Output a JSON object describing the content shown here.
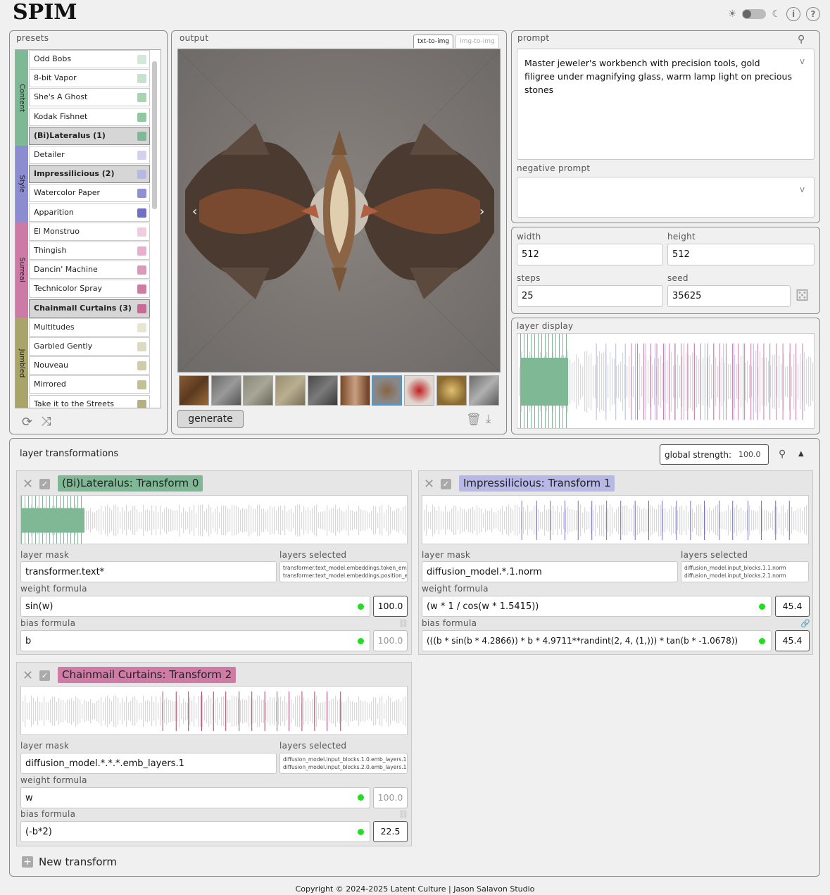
{
  "app": {
    "title": "SPIM"
  },
  "presets": {
    "label": "presets",
    "groups": [
      {
        "name": "Content",
        "color": "#7fb894"
      },
      {
        "name": "Style",
        "color": "#8c8cd0"
      },
      {
        "name": "Surreal",
        "color": "#cc7aa6"
      },
      {
        "name": "Jumbled",
        "color": "#a8a46a"
      }
    ],
    "items": [
      {
        "label": "Odd Bobs",
        "swatch": "#d4e8da",
        "selected": false
      },
      {
        "label": "8-bit Vapor",
        "swatch": "#c4e2cc",
        "selected": false
      },
      {
        "label": "She's A Ghost",
        "swatch": "#a8d4b4",
        "selected": false
      },
      {
        "label": "Kodak Fishnet",
        "swatch": "#90c8a0",
        "selected": false
      },
      {
        "label": "(Bi)Lateralus (1)",
        "swatch": "#7fb894",
        "selected": true
      },
      {
        "label": "Detailer",
        "swatch": "#d2d2ee",
        "selected": false
      },
      {
        "label": "Impressilicious (2)",
        "swatch": "#b8b8e6",
        "selected": true
      },
      {
        "label": "Watercolor Paper",
        "swatch": "#9090d4",
        "selected": false
      },
      {
        "label": "Apparition",
        "swatch": "#7070c4",
        "selected": false
      },
      {
        "label": "El Monstruo",
        "swatch": "#f0ccde",
        "selected": false
      },
      {
        "label": "Thingish",
        "swatch": "#e8b0cc",
        "selected": false
      },
      {
        "label": "Dancin' Machine",
        "swatch": "#de98ba",
        "selected": false
      },
      {
        "label": "Technicolor Spray",
        "swatch": "#d07aa6",
        "selected": false
      },
      {
        "label": "Chainmail Curtains (3)",
        "swatch": "#c86a98",
        "selected": true
      },
      {
        "label": "Multitudes",
        "swatch": "#e6e6d2",
        "selected": false
      },
      {
        "label": "Garbled Gently",
        "swatch": "#dcdac0",
        "selected": false
      },
      {
        "label": "Nouveau",
        "swatch": "#d0cca8",
        "selected": false
      },
      {
        "label": "Mirrored",
        "swatch": "#c4c096",
        "selected": false
      },
      {
        "label": "Take it to the Streets",
        "swatch": "#b4b080",
        "selected": false
      }
    ]
  },
  "output": {
    "label": "output",
    "tabs": [
      "txt-to-img",
      "img-to-img"
    ],
    "generate_label": "generate"
  },
  "prompt": {
    "label": "prompt",
    "value": "Master jeweler's workbench with precision tools, gold filigree under magnifying glass, warm lamp light on precious stones",
    "negative_label": "negative prompt",
    "negative_value": ""
  },
  "params": {
    "width_label": "width",
    "width": "512",
    "height_label": "height",
    "height": "512",
    "steps_label": "steps",
    "steps": "25",
    "seed_label": "seed",
    "seed": "35625"
  },
  "layer_display": {
    "label": "layer display"
  },
  "layer_transformations": {
    "label": "layer transformations",
    "global_strength_label": "global strength:",
    "global_strength": "100.0",
    "new_transform_label": "New transform",
    "transforms": [
      {
        "title": "(Bi)Lateralus: Transform 0",
        "color": "#7fb894",
        "layer_mask_label": "layer mask",
        "layer_mask": "transformer.text*",
        "layers_selected_label": "layers selected",
        "layers_selected": [
          "transformer.text_model.embeddings.token_embed",
          "transformer.text_model.embeddings.position_emb"
        ],
        "weight_label": "weight formula",
        "weight": "sin(w)",
        "weight_value": "100.0",
        "bias_label": "bias formula",
        "bias": "b",
        "bias_value": "100.0"
      },
      {
        "title": "Impressilicious: Transform 1",
        "color": "#b8b8e6",
        "layer_mask_label": "layer mask",
        "layer_mask": "diffusion_model.*.1.norm",
        "layers_selected_label": "layers selected",
        "layers_selected": [
          "diffusion_model.input_blocks.1.1.norm",
          "diffusion_model.input_blocks.2.1.norm"
        ],
        "weight_label": "weight formula",
        "weight": "(w * 1 / cos(w * 1.5415))",
        "weight_value": "45.4",
        "bias_label": "bias formula",
        "bias": "(((b * sin(b * 4.2866)) * b * 4.9711**randint(2, 4, (1,))) * tan(b * -1.0678))",
        "bias_value": "45.4"
      },
      {
        "title": "Chainmail Curtains: Transform 2",
        "color": "#d07aa6",
        "layer_mask_label": "layer mask",
        "layer_mask": "diffusion_model.*.*.*.emb_layers.1",
        "layers_selected_label": "layers selected",
        "layers_selected": [
          "diffusion_model.input_blocks.1.0.emb_layers.1",
          "diffusion_model.input_blocks.2.0.emb_layers.1"
        ],
        "weight_label": "weight formula",
        "weight": "w",
        "weight_value": "100.0",
        "bias_label": "bias formula",
        "bias": "(-b*2)",
        "bias_value": "22.5"
      }
    ]
  },
  "footer": {
    "text": "Copyright © 2024-2025  Latent Culture | Jason Salavon Studio"
  }
}
